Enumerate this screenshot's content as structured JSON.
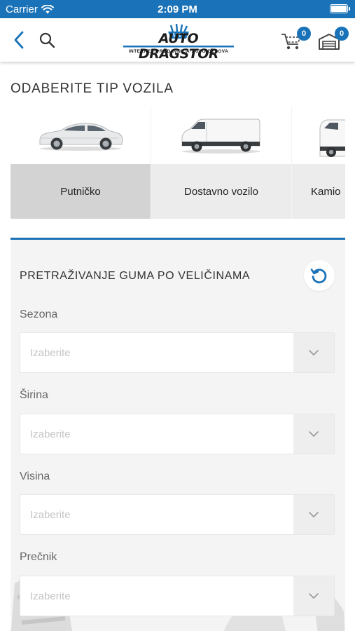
{
  "status_bar": {
    "carrier": "Carrier",
    "time": "2:09 PM"
  },
  "header": {
    "logo_text": "AUTO DRAGSTOR",
    "logo_tagline": "INTERNET·PRODAVNICA·AUTO·DELOVA",
    "cart_count": "0",
    "garage_count": "0"
  },
  "vehicle_types": {
    "title": "ODABERITE TIP VOZILA",
    "items": [
      {
        "label": "Putničko",
        "icon": "sedan-car-image",
        "selected": true
      },
      {
        "label": "Dostavno vozilo",
        "icon": "delivery-van-image",
        "selected": false
      },
      {
        "label": "Kamio",
        "icon": "truck-image",
        "selected": false
      }
    ]
  },
  "tire_search": {
    "title": "PRETRAŽIVANJE GUMA PO VELIČINAMA",
    "reset_icon": "refresh-icon",
    "fields": [
      {
        "label": "Sezona",
        "placeholder": "Izaberite"
      },
      {
        "label": "Širina",
        "placeholder": "Izaberite"
      },
      {
        "label": "Visina",
        "placeholder": "Izaberite"
      },
      {
        "label": "Prečnik",
        "placeholder": "Izaberite"
      }
    ]
  },
  "colors": {
    "brand_blue": "#1a73b8",
    "panel_bg": "#f4f4f4",
    "selected_card": "#d3d3d3"
  }
}
